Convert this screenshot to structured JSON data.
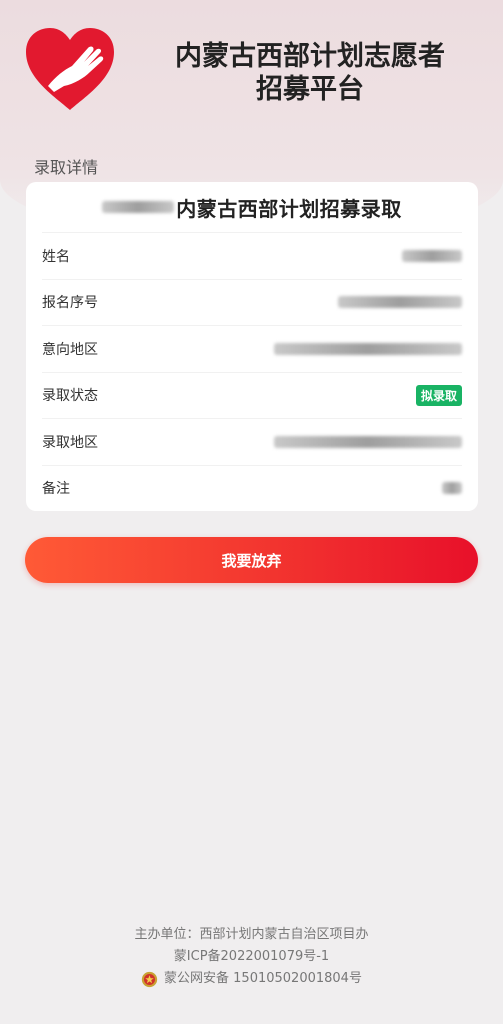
{
  "header": {
    "title_line1": "内蒙古西部计划志愿者",
    "title_line2": "招募平台"
  },
  "section_label": "录取详情",
  "card": {
    "title": "内蒙古西部计划招募录取",
    "rows": [
      {
        "label": "姓名"
      },
      {
        "label": "报名序号"
      },
      {
        "label": "意向地区"
      },
      {
        "label": "录取状态",
        "badge": "拟录取"
      },
      {
        "label": "录取地区"
      },
      {
        "label": "备注"
      }
    ]
  },
  "action_button": "我要放弃",
  "footer": {
    "sponsor": "主办单位：西部计划内蒙古自治区项目办",
    "icp": "蒙ICP备2022001079号-1",
    "police": "蒙公网安备 15010502001804号"
  },
  "colors": {
    "accent": "#e8102a",
    "badge": "#19b364",
    "logo": "#e2192f"
  }
}
